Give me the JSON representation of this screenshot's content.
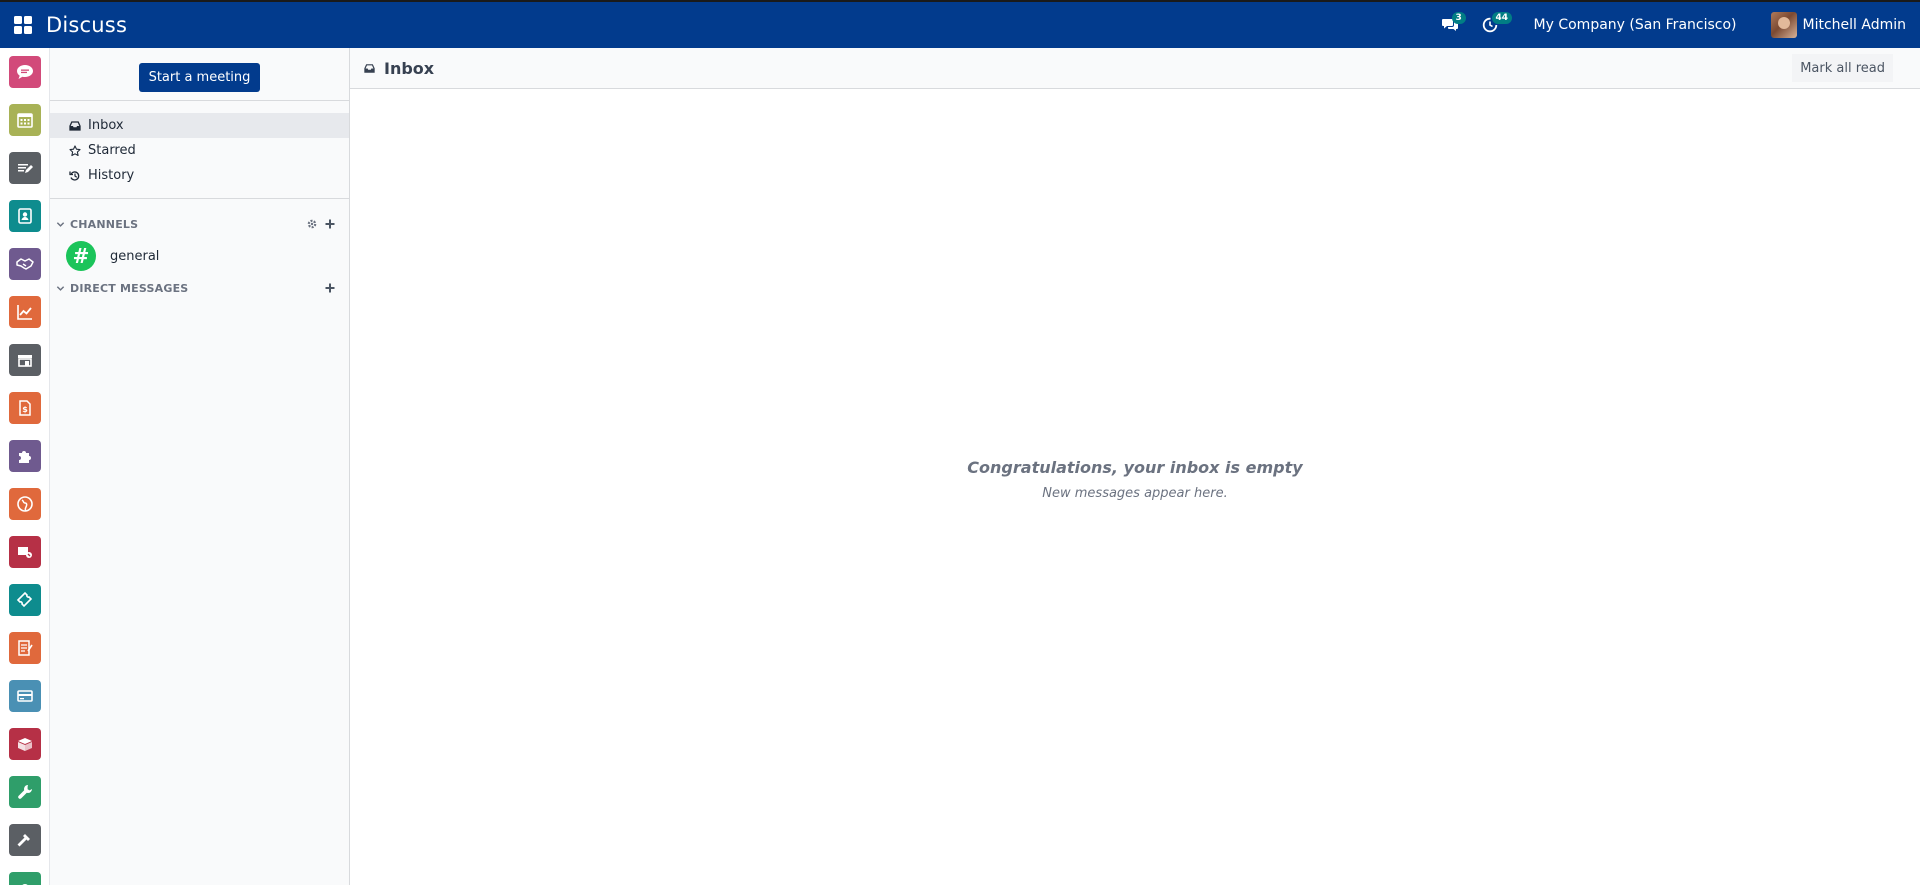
{
  "topbar": {
    "app_title": "Discuss",
    "messages_badge": "3",
    "activities_badge": "44",
    "company": "My Company (San Francisco)",
    "user_name": "Mitchell Admin",
    "bg_color": "#023b8d"
  },
  "app_strip": [
    {
      "name": "discuss-app",
      "icon": "chat-bubble-icon",
      "color": "#d24a7a"
    },
    {
      "name": "calendar-app",
      "icon": "calendar-icon",
      "color": "#a8b256"
    },
    {
      "name": "notes-app",
      "icon": "notes-icon",
      "color": "#5b5f64"
    },
    {
      "name": "contacts-app",
      "icon": "contact-card-icon",
      "color": "#0e8c8e"
    },
    {
      "name": "crm-app",
      "icon": "handshake-icon",
      "color": "#6f5a8f"
    },
    {
      "name": "sales-app",
      "icon": "trend-chart-icon",
      "color": "#e0693c"
    },
    {
      "name": "point-of-sale-app",
      "icon": "shop-icon",
      "color": "#5b5f64"
    },
    {
      "name": "invoicing-app",
      "icon": "invoice-icon",
      "color": "#e0693c"
    },
    {
      "name": "project-app",
      "icon": "puzzle-icon",
      "color": "#6f5a8f"
    },
    {
      "name": "website-app",
      "icon": "globe-icon",
      "color": "#e0693c"
    },
    {
      "name": "email-marketing-app",
      "icon": "megaphone-icon",
      "color": "#b63046"
    },
    {
      "name": "events-app",
      "icon": "ticket-icon",
      "color": "#0e8c8e"
    },
    {
      "name": "surveys-app",
      "icon": "checklist-icon",
      "color": "#e0693c"
    },
    {
      "name": "payments-app",
      "icon": "credit-card-icon",
      "color": "#4a90b4"
    },
    {
      "name": "inventory-app",
      "icon": "box-icon",
      "color": "#b63046"
    },
    {
      "name": "maintenance-app",
      "icon": "wrench-icon",
      "color": "#2f9e6a"
    },
    {
      "name": "manufacturing-app",
      "icon": "hammer-icon",
      "color": "#5b5f64"
    },
    {
      "name": "more-app",
      "icon": "app-icon",
      "color": "#2f9e6a"
    }
  ],
  "sidebar": {
    "start_meeting_label": "Start a meeting",
    "mailboxes": [
      {
        "label": "Inbox",
        "icon": "inbox-icon",
        "active": true
      },
      {
        "label": "Starred",
        "icon": "star-icon",
        "active": false
      },
      {
        "label": "History",
        "icon": "history-icon",
        "active": false
      }
    ],
    "channels_header": "CHANNELS",
    "channels": [
      {
        "label": "general",
        "icon": "#"
      }
    ],
    "direct_messages_header": "DIRECT MESSAGES"
  },
  "main": {
    "title": "Inbox",
    "mark_all_read_label": "Mark all read",
    "empty_title": "Congratulations, your inbox is empty",
    "empty_subtitle": "New messages appear here."
  }
}
